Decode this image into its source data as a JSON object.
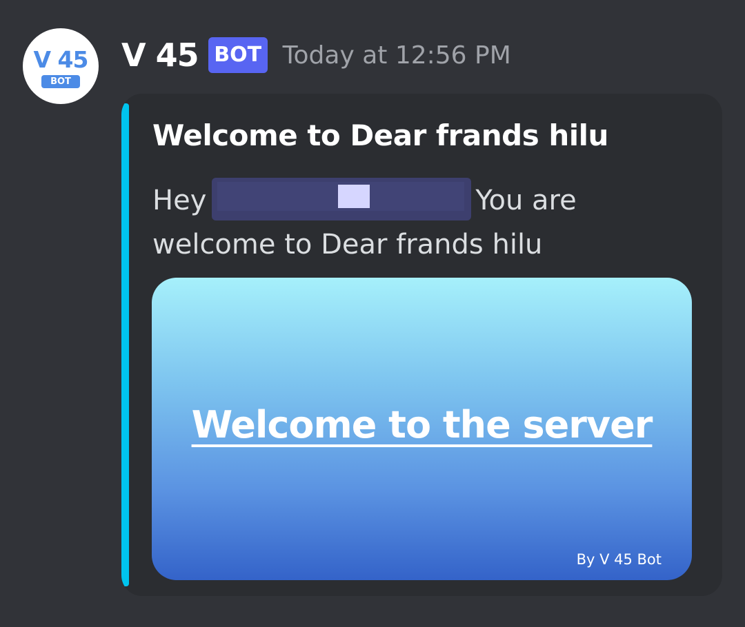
{
  "author": {
    "avatar_name": "V 45",
    "avatar_badge": "BOT",
    "name": "V 45",
    "tag": "BOT",
    "timestamp": "Today at 12:56 PM"
  },
  "embed": {
    "accent_color": "#00c4ee",
    "title": "Welcome to Dear frands hilu",
    "desc_prefix": "Hey",
    "desc_suffix": "You are",
    "desc_line2": "welcome to Dear frands hilu",
    "image": {
      "title": "Welcome to the server",
      "credit": "By V 45 Bot"
    }
  }
}
